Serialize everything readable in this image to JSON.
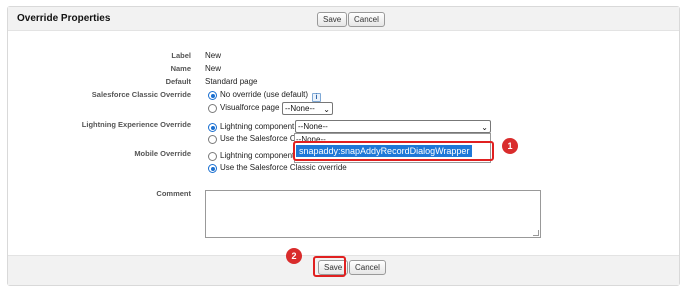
{
  "title": "Override Properties",
  "buttons": {
    "save": "Save",
    "cancel": "Cancel"
  },
  "fields": {
    "label": {
      "label": "Label",
      "value": "New"
    },
    "name": {
      "label": "Name",
      "value": "New"
    },
    "default": {
      "label": "Default",
      "value": "Standard page"
    },
    "classic": {
      "label": "Salesforce Classic Override",
      "opt1": "No override (use default)",
      "opt2": "Visualforce page",
      "select": "--None--"
    },
    "lightning": {
      "label": "Lightning Experience Override",
      "opt1": "Lightning component",
      "select": "--None--",
      "opt2_partial": "Use the Salesforce C"
    },
    "mobile": {
      "label": "Mobile Override",
      "opt1_partial": "Lightning component",
      "opt2": "Use the Salesforce Classic override"
    },
    "comment": {
      "label": "Comment",
      "value": ""
    }
  },
  "dropdown": {
    "options": [
      "--None--",
      "snapaddy:snapAddyRecordDialogWrapper"
    ],
    "selected": "snapaddy:snapAddyRecordDialogWrapper"
  },
  "annotations": {
    "step1": "1",
    "step2": "2",
    "highlight_color": "#e02020"
  },
  "icons": {
    "info": "i",
    "caret": "⌄"
  }
}
